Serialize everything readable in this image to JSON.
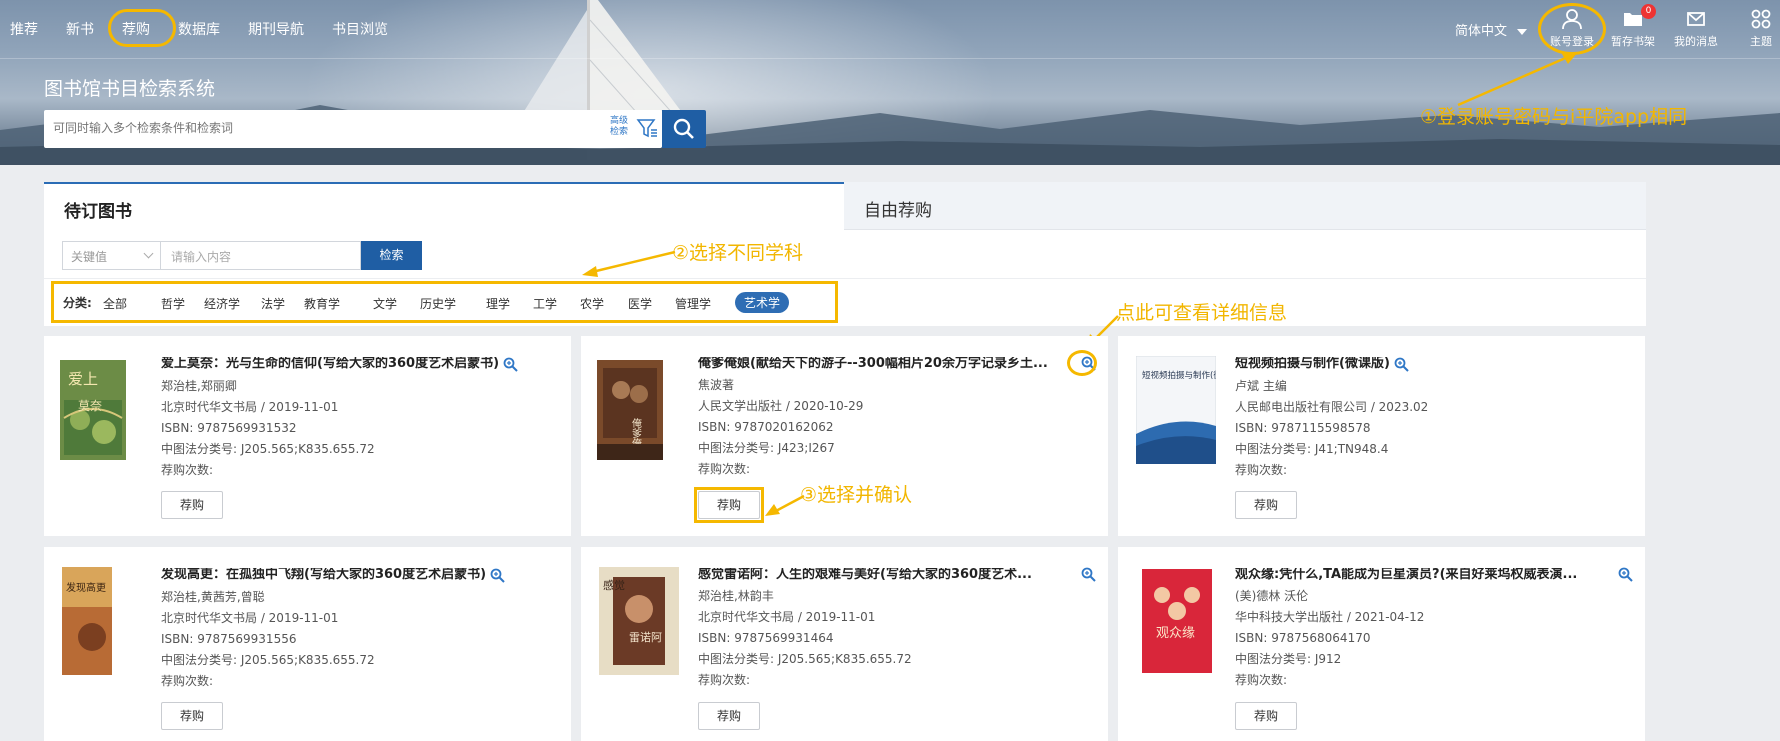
{
  "nav": {
    "items": [
      "推荐",
      "新书",
      "荐购",
      "数据库",
      "期刊导航",
      "书目浏览"
    ],
    "active": "荐购"
  },
  "header": {
    "language": "简体中文",
    "tools": [
      {
        "icon": "user-icon",
        "label": "账号登录"
      },
      {
        "icon": "folder-icon",
        "label": "暂存书架",
        "badge": "0"
      },
      {
        "icon": "mail-icon",
        "label": "我的消息"
      },
      {
        "icon": "theme-grid-icon",
        "label": "主题"
      }
    ],
    "system_title": "图书馆书目检索系统",
    "search_placeholder": "可同时输入多个检索条件和检索词",
    "advanced_search": "高级检索"
  },
  "annotations": {
    "login": "①登录账号密码与i平院app相同",
    "subject": "②选择不同学科",
    "detail": "点此可查看详细信息",
    "confirm": "③选择并确认"
  },
  "tabs": [
    "待订图书",
    "自由荐购"
  ],
  "filter": {
    "keyword_select": "关键值",
    "input_placeholder": "请输入内容",
    "search_button": "检索",
    "category_label": "分类:",
    "categories": [
      "全部",
      "哲学",
      "经济学",
      "法学",
      "教育学",
      "文学",
      "历史学",
      "理学",
      "工学",
      "农学",
      "医学",
      "管理学",
      "艺术学"
    ],
    "selected_category": "艺术学"
  },
  "books": [
    {
      "title": "爱上莫奈：光与生命的信仰(写给大家的360度艺术启蒙书)",
      "author": "郑治桂,郑丽卿",
      "publisher": "北京时代华文书局 / 2019-11-01",
      "isbn": "ISBN:  9787569931532",
      "clc": "中图法分类号:  J205.565;K835.655.72",
      "count": "荐购次数:",
      "button": "荐购"
    },
    {
      "title": "俺爹俺娘(献给天下的游子--300幅相片20余万字记录乡土...",
      "author": "焦波著",
      "publisher": "人民文学出版社 / 2020-10-29",
      "isbn": "ISBN:  9787020162062",
      "clc": "中图法分类号:  J423;I267",
      "count": "荐购次数:",
      "button": "荐购"
    },
    {
      "title": "短视频拍摄与制作(微课版)",
      "author": "卢斌 主编",
      "publisher": "人民邮电出版社有限公司 / 2023.02",
      "isbn": "ISBN:  9787115598578",
      "clc": "中图法分类号:  J41;TN948.4",
      "count": "荐购次数:",
      "button": "荐购"
    },
    {
      "title": "发现高更：在孤独中飞翔(写给大家的360度艺术启蒙书)",
      "author": "郑治桂,黄茜芳,曾聪",
      "publisher": "北京时代华文书局 / 2019-11-01",
      "isbn": "ISBN:  9787569931556",
      "clc": "中图法分类号:  J205.565;K835.655.72",
      "count": "荐购次数:",
      "button": "荐购"
    },
    {
      "title": "感觉雷诺阿：人生的艰难与美好(写给大家的360度艺术...",
      "author": "郑治桂,林韵丰",
      "publisher": "北京时代华文书局 / 2019-11-01",
      "isbn": "ISBN:  9787569931464",
      "clc": "中图法分类号:  J205.565;K835.655.72",
      "count": "荐购次数:",
      "button": "荐购"
    },
    {
      "title": "观众缘:凭什么,TA能成为巨星演员?(来自好莱坞权威表演...",
      "author": "(美)德林 沃伦",
      "publisher": "华中科技大学出版社 / 2021-04-12",
      "isbn": "ISBN:  9787568064170",
      "clc": "中图法分类号:  J912",
      "count": "荐购次数:",
      "button": "荐购"
    }
  ],
  "book_covers": [
    {
      "title": "爱上",
      "subtitle": "莫奈"
    },
    {
      "title": "俺爹俺娘"
    },
    {
      "title": "短视频拍摄与制作(微课版)"
    },
    {
      "title": "发现高更"
    },
    {
      "title": "感觉",
      "subtitle": "雷诺阿"
    },
    {
      "title": "观众缘"
    }
  ],
  "colors": {
    "accent": "#1f5ea4",
    "annotation": "#f5b800",
    "selected_category": "#2e6db4"
  }
}
